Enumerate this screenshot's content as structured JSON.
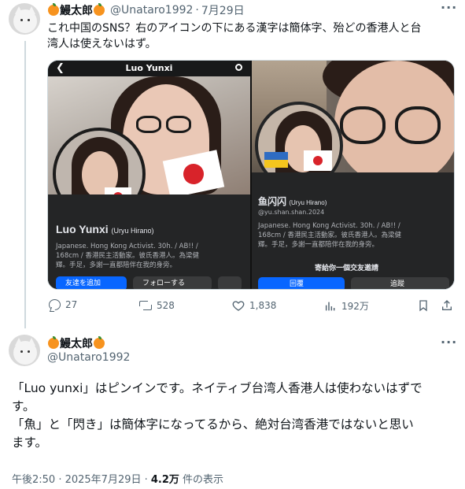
{
  "reply_tweet": {
    "author_name": "鰻太郎",
    "handle": "@Unataro1992",
    "date": "7月29日",
    "text_line1": "これ中国のSNS？右のアイコンの下にある漢字は簡体字、殆どの香港人と台",
    "text_line2": "湾人は使えないはず。",
    "more_icon": "more-horizontal-icon",
    "media": {
      "left": {
        "top_title": "Luo Yunxi",
        "name": "Luo Yunxi",
        "sub_name": "(Uryu Hirano)",
        "bio_line1": "Japanese. Hong Kong Activist. 30h. / AB!! /",
        "bio_line2": "168cm / 香港民主活動家。彼氏香港人。為梁健",
        "bio_line3": "輝。手足，多謝一直都陪伴在我的身旁。",
        "button1": "友達を追加",
        "button2": "フォローする"
      },
      "right": {
        "name": "鱼闪闪",
        "sub_name": "(Uryu Hirano)",
        "handle": "@yu.shan.shan.2024",
        "bio_line1": "Japanese. Hong Kong Activist. 30h. / AB!! /",
        "bio_line2": "168cm / 香港民主活動家。彼氏香港人。為梁健",
        "bio_line3": "輝。手足，多謝一直都陪伴在我的身旁。",
        "invite": "寄給你一個交友邀請",
        "button1": "回覆",
        "button2": "追蹤"
      }
    },
    "actions": {
      "replies": "27",
      "retweets": "528",
      "likes": "1,838",
      "views": "192万"
    }
  },
  "main_tweet": {
    "author_name": "鰻太郎",
    "handle": "@Unataro1992",
    "text_line1": "「Luo yunxi」はピンインです。ネイティブ台湾人香港人は使わないはずで",
    "text_line2": "す。",
    "text_line3": "「魚」と「閃き」は簡体字になってるから、絶対台湾香港ではないと思い",
    "text_line4": "ます。",
    "timestamp": "午後2:50 · 2025年7月29日 · ",
    "views_count": "4.2万",
    "views_label": " 件の表示"
  },
  "colors": {
    "text_primary": "#0f1419",
    "text_secondary": "#536471",
    "fb_dark": "#242526",
    "fb_blue": "#0866ff",
    "orange": "#f7931e"
  }
}
